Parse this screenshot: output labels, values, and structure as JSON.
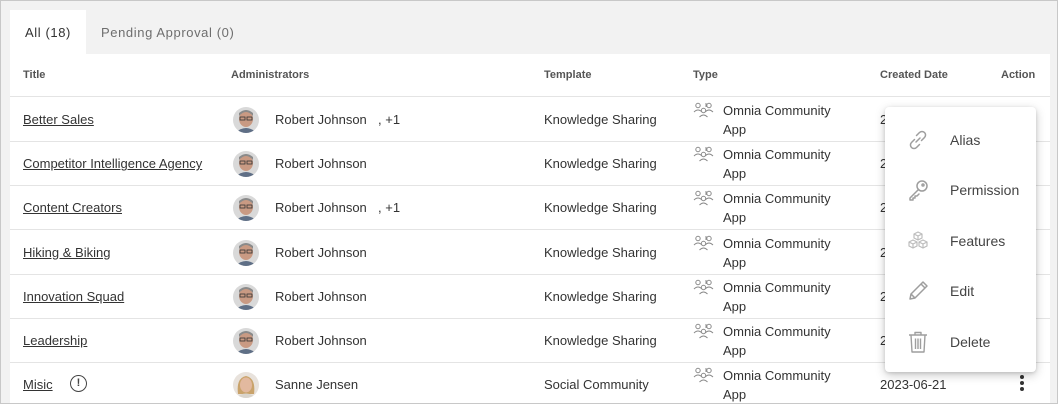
{
  "tabs": [
    {
      "label": "All (18)",
      "active": true
    },
    {
      "label": "Pending Approval (0)",
      "active": false
    }
  ],
  "columns": {
    "title": "Title",
    "administrators": "Administrators",
    "template": "Template",
    "type": "Type",
    "created": "Created Date",
    "action": "Action"
  },
  "rows": [
    {
      "title": "Better Sales",
      "admin": "Robert Johnson",
      "extra": ", +1",
      "template": "Knowledge Sharing",
      "type_line1": "Omnia Community",
      "type_line2": "App",
      "date": ""
    },
    {
      "title": "Competitor Intelligence Agency",
      "admin": "Robert Johnson",
      "extra": "",
      "template": "Knowledge Sharing",
      "type_line1": "Omnia Community",
      "type_line2": "App",
      "date": ""
    },
    {
      "title": "Content Creators",
      "admin": "Robert Johnson",
      "extra": ", +1",
      "template": "Knowledge Sharing",
      "type_line1": "Omnia Community",
      "type_line2": "App",
      "date": ""
    },
    {
      "title": "Hiking & Biking",
      "admin": "Robert Johnson",
      "extra": "",
      "template": "Knowledge Sharing",
      "type_line1": "Omnia Community",
      "type_line2": "App",
      "date": ""
    },
    {
      "title": "Innovation Squad",
      "admin": "Robert Johnson",
      "extra": "",
      "template": "Knowledge Sharing",
      "type_line1": "Omnia Community",
      "type_line2": "App",
      "date": ""
    },
    {
      "title": "Leadership",
      "admin": "Robert Johnson",
      "extra": "",
      "template": "Knowledge Sharing",
      "type_line1": "Omnia Community",
      "type_line2": "App",
      "date": ""
    },
    {
      "title": "Misic",
      "admin": "Sanne Jensen",
      "extra": "",
      "template": "Social Community",
      "type_line1": "Omnia Community",
      "type_line2": "App",
      "date": "2023-06-21"
    }
  ],
  "partial_dates": [
    "2",
    "2",
    "2",
    "2",
    "2",
    "2"
  ],
  "info_icon_glyph": "!",
  "action_menu": [
    {
      "label": "Alias",
      "icon": "link-icon"
    },
    {
      "label": "Permission",
      "icon": "key-icon"
    },
    {
      "label": "Features",
      "icon": "cubes-icon"
    },
    {
      "label": "Edit",
      "icon": "pencil-icon"
    },
    {
      "label": "Delete",
      "icon": "trash-icon"
    }
  ],
  "colors": {
    "background": "#f2f2f2",
    "panel": "#ffffff",
    "text": "#333333",
    "icon": "#9e9e9e"
  }
}
